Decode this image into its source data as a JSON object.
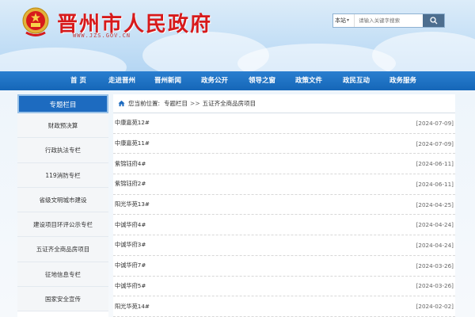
{
  "header": {
    "title": "晋州市人民政府",
    "url": "WWW.JZS.GOV.CN",
    "emblem_icon": "national-emblem-icon",
    "title_color": "#d71a1b"
  },
  "search": {
    "scope": "本站",
    "placeholder": "请输入关键字搜索",
    "button_icon": "search-icon"
  },
  "nav": {
    "items": [
      {
        "label": "首 页"
      },
      {
        "label": "走进晋州"
      },
      {
        "label": "晋州新闻"
      },
      {
        "label": "政务公开"
      },
      {
        "label": "领导之窗"
      },
      {
        "label": "政策文件"
      },
      {
        "label": "政民互动"
      },
      {
        "label": "政务服务"
      }
    ],
    "bg_color": "#1d6bc0"
  },
  "sidebar": {
    "title": "专题栏目",
    "items": [
      {
        "label": "财政预决算"
      },
      {
        "label": "行政执法专栏"
      },
      {
        "label": "119消防专栏"
      },
      {
        "label": "省级文明城市建设"
      },
      {
        "label": "建设项目环评公示专栏"
      },
      {
        "label": "五证齐全商品房项目"
      },
      {
        "label": "征地信息专栏"
      },
      {
        "label": "国家安全宣传"
      }
    ]
  },
  "breadcrumb": {
    "home_icon": "home-icon",
    "prefix": "您当前位置:",
    "level1": "专题栏目",
    "separator": ">>",
    "level2": "五证齐全商品房项目"
  },
  "articles": [
    {
      "title": "中康嘉苑12#",
      "date": "[2024-07-09]"
    },
    {
      "title": "中康嘉苑11#",
      "date": "[2024-07-09]"
    },
    {
      "title": "紫锦钰府4#",
      "date": "[2024-06-11]"
    },
    {
      "title": "紫锦钰府2#",
      "date": "[2024-06-11]"
    },
    {
      "title": "阳光华苑13#",
      "date": "[2024-04-25]"
    },
    {
      "title": "中诚华府4#",
      "date": "[2024-04-24]"
    },
    {
      "title": "中诚华府3#",
      "date": "[2024-04-24]"
    },
    {
      "title": "中诚华府7#",
      "date": "[2024-03-26]"
    },
    {
      "title": "中诚华府5#",
      "date": "[2024-03-26]"
    },
    {
      "title": "阳光华苑14#",
      "date": "[2024-02-02]"
    }
  ]
}
